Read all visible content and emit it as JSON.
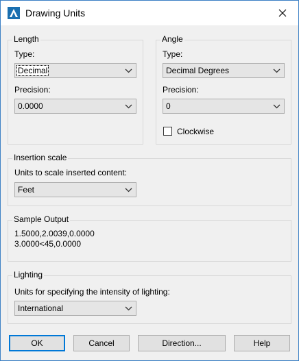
{
  "window": {
    "title": "Drawing Units",
    "icons": {
      "app": "autocad-a-icon",
      "close": "close-icon"
    }
  },
  "length": {
    "group_title": "Length",
    "type_label": "Type:",
    "type_value": "Decimal",
    "precision_label": "Precision:",
    "precision_value": "0.0000"
  },
  "angle": {
    "group_title": "Angle",
    "type_label": "Type:",
    "type_value": "Decimal Degrees",
    "precision_label": "Precision:",
    "precision_value": "0",
    "clockwise_label": "Clockwise",
    "clockwise_checked": false
  },
  "insertion_scale": {
    "group_title": "Insertion scale",
    "label": "Units to scale inserted content:",
    "value": "Feet"
  },
  "sample_output": {
    "group_title": "Sample Output",
    "line1": "1.5000,2.0039,0.0000",
    "line2": "3.0000<45,0.0000"
  },
  "lighting": {
    "group_title": "Lighting",
    "label": "Units for specifying the intensity of lighting:",
    "value": "International"
  },
  "buttons": {
    "ok": "OK",
    "cancel": "Cancel",
    "direction": "Direction...",
    "help": "Help"
  },
  "colors": {
    "window_border": "#3a7fc4",
    "default_button_border": "#0078d7",
    "dialog_background": "#f0f0f0"
  }
}
